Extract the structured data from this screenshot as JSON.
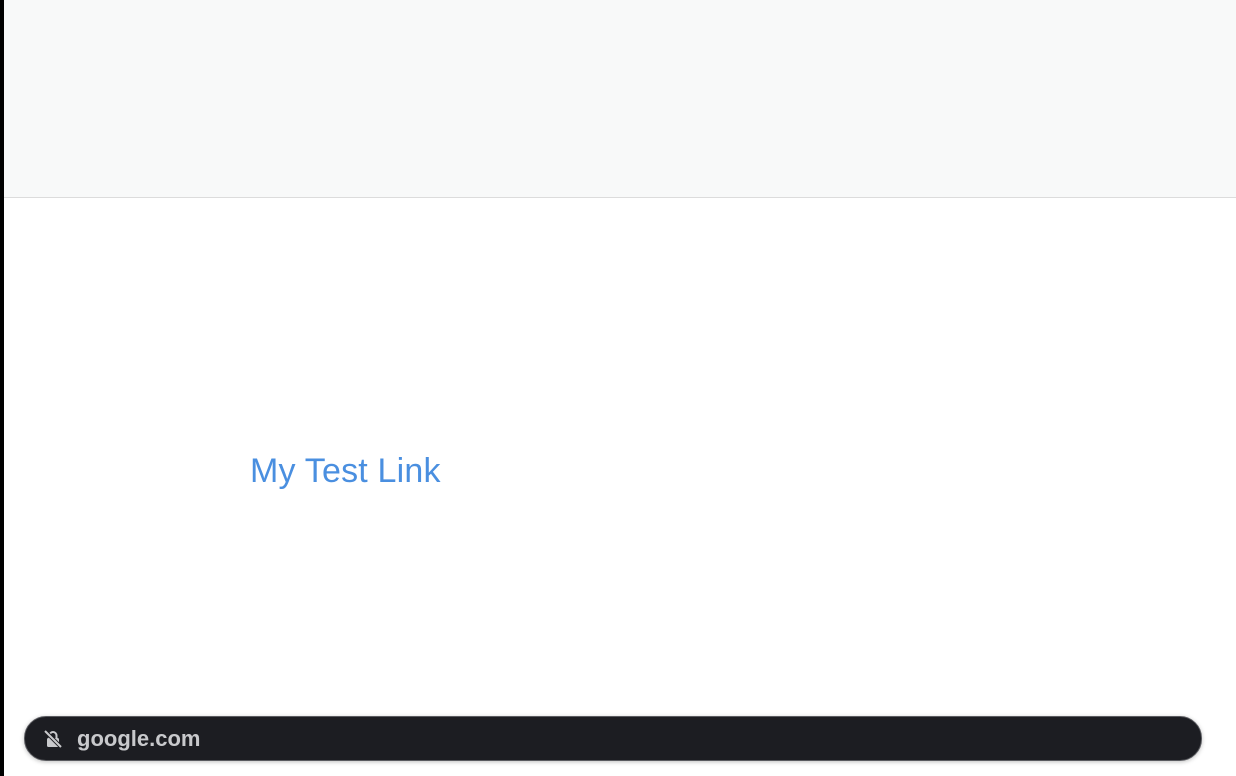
{
  "header": {
    "background": "#f8f9f9"
  },
  "main": {
    "link_label": "My Test Link",
    "link_color": "#4a8fe0"
  },
  "status_bar": {
    "url": "google.com",
    "icon": "not-secure-lock-icon"
  }
}
